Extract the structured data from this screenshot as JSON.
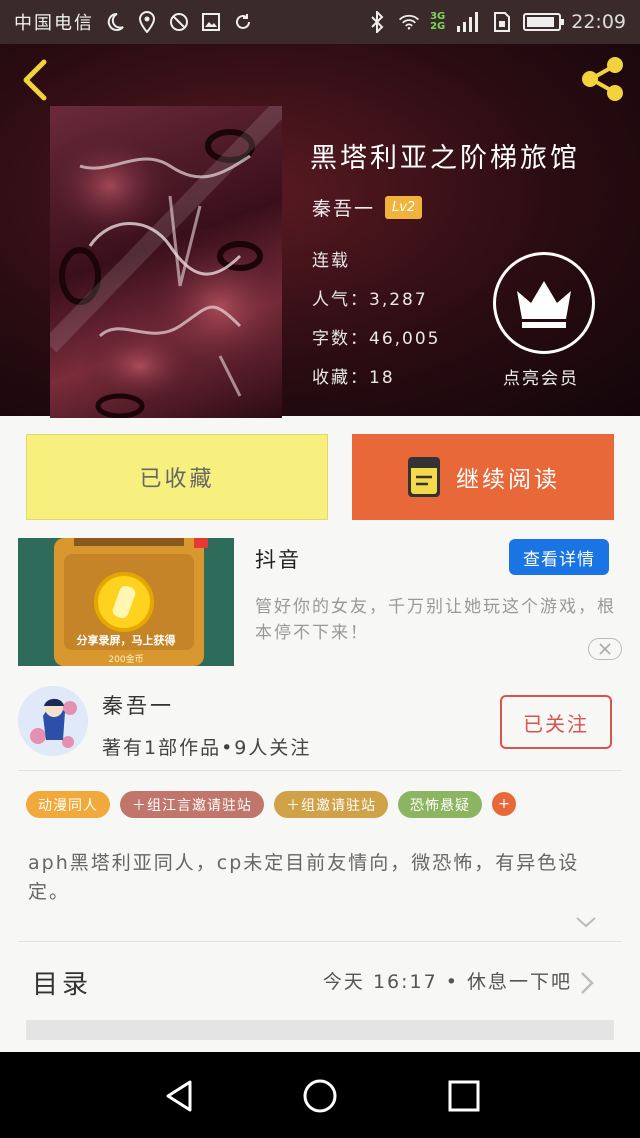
{
  "status_bar": {
    "carrier": "中国电信",
    "network_types": [
      "3G",
      "2G"
    ],
    "time": "22:09",
    "left_icons": [
      "moon-icon",
      "location-icon",
      "no-disturb-icon",
      "image-icon",
      "sync-icon"
    ],
    "right_icons": [
      "bluetooth-icon",
      "wifi-icon",
      "signal-icon",
      "sim-icon",
      "battery-icon"
    ]
  },
  "book": {
    "title": "黑塔利亚之阶梯旅馆",
    "author": "秦吾一",
    "level": "Lv2",
    "status": "连载",
    "popularity": "人气：3,287",
    "word_count": "字数：46,005",
    "favorites": "收藏：18",
    "vip_label": "点亮会员"
  },
  "actions": {
    "collected_label": "已收藏",
    "continue_label": "继续阅读"
  },
  "ad": {
    "title": "抖音",
    "detail_button": "查看详情",
    "description": "管好你的女友，千万别让她玩这个游戏，根本停不下来！",
    "image_caption": "分享录屏，马上获得",
    "image_sub": "200金币"
  },
  "author": {
    "name": "秦吾一",
    "stats": "著有1部作品•9人关注",
    "follow_label": "已关注"
  },
  "tags": [
    {
      "label": "动漫同人",
      "color": "#f2a93b"
    },
    {
      "label": "＋组江言邀请驻站",
      "color": "#c0766a"
    },
    {
      "label": "＋组邀请驻站",
      "color": "#d0a248"
    },
    {
      "label": "恐怖悬疑",
      "color": "#8cb561"
    }
  ],
  "tag_more": "+",
  "description": "aph黑塔利亚同人，cp未定目前友情向，微恐怖，有异色设定。",
  "toc": {
    "label": "目录",
    "latest": "今天 16:17 • 休息一下吧"
  },
  "colors": {
    "accent_orange": "#e8683a",
    "collected_yellow": "#f8f07e",
    "follow_red": "#d9534f",
    "detail_blue": "#1b74e4"
  }
}
